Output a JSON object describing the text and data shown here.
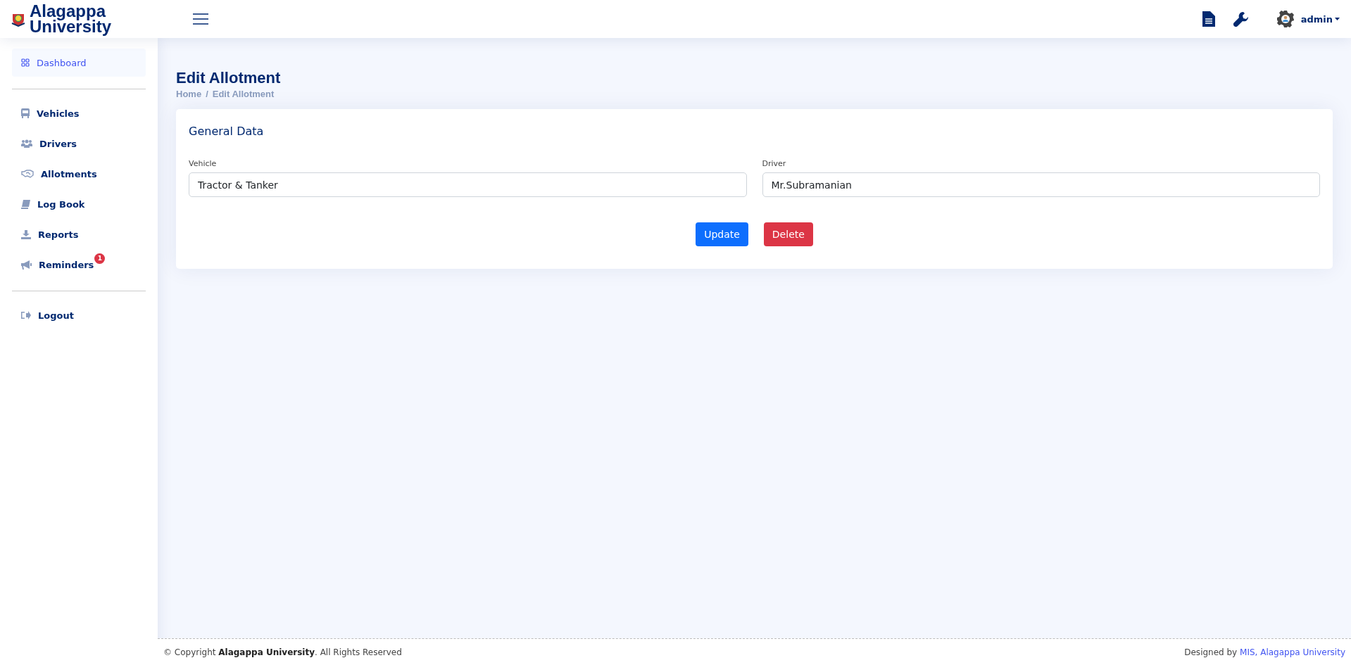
{
  "header": {
    "logo_line_1": "Alagappa",
    "logo_line_2": "University",
    "user": "admin"
  },
  "sidebar": {
    "groups": [
      {
        "items": [
          {
            "label": "Dashboard",
            "kind": "dashboard",
            "selected": true
          }
        ]
      },
      {
        "items": [
          {
            "label": "Vehicles",
            "kind": "bus",
            "selected": false
          },
          {
            "label": "Drivers",
            "kind": "users",
            "selected": false
          },
          {
            "label": "Allotments",
            "kind": "handshake",
            "selected": false
          },
          {
            "label": "Log Book",
            "kind": "book",
            "selected": false
          },
          {
            "label": "Reports",
            "kind": "download",
            "selected": false
          },
          {
            "label": "Reminders",
            "kind": "megaphone",
            "selected": false,
            "badge": "1"
          }
        ]
      },
      {
        "items": [
          {
            "label": "Logout",
            "kind": "logout",
            "selected": false
          }
        ]
      }
    ]
  },
  "page": {
    "title": "Edit Allotment",
    "breadcrumb": [
      "Home",
      "Edit Allotment"
    ],
    "breadcrumb_separator": "/"
  },
  "card": {
    "title": "General Data",
    "fields": [
      {
        "label": "Vehicle",
        "value": "Tractor & Tanker"
      },
      {
        "label": "Driver",
        "value": "Mr.Subramanian"
      }
    ],
    "buttons": [
      {
        "label": "Update",
        "kind": "primary"
      },
      {
        "label": "Delete",
        "kind": "danger"
      }
    ]
  },
  "footer": {
    "copyright": "© Copyright **Alagappa University**. All Rights Reserved",
    "designed_by": "Designed by",
    "designer_link": "MIS, Alagappa University"
  }
}
